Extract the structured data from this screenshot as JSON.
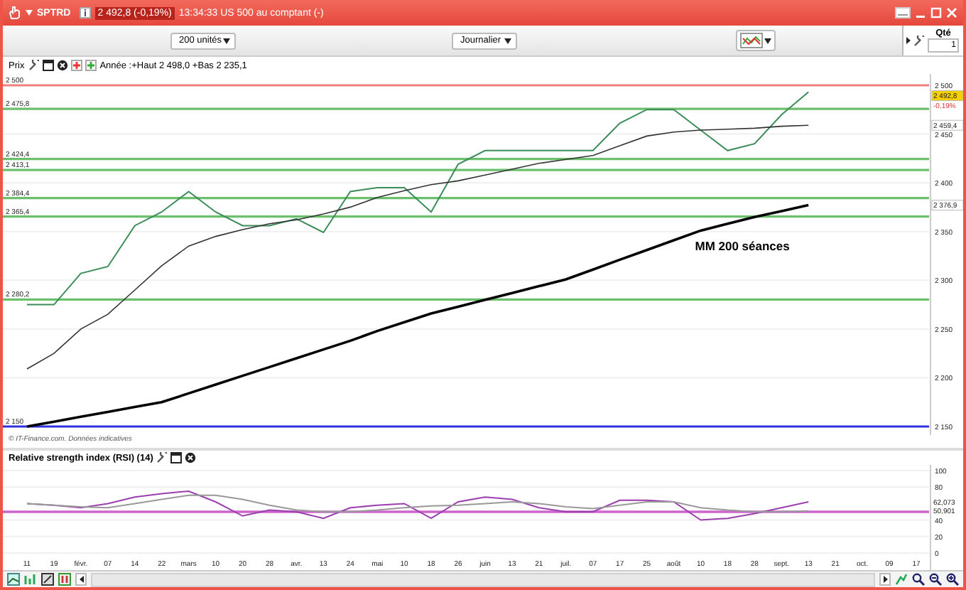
{
  "window": {
    "symbol": "SPTRD",
    "quote": "2 492,8 (-0,19%)",
    "subtitle": "13:34:33 US 500 au comptant (-)"
  },
  "toolbar": {
    "period_count": "200 unités",
    "interval": "Journalier",
    "quantity_label": "Qté",
    "quantity": "1"
  },
  "price_panel": {
    "title": "Prix",
    "summary": "Année :+Haut 2 498,0 +Bas 2 235,1",
    "chart_data": {
      "type": "line",
      "ylim": [
        2140,
        2500
      ],
      "grid": true,
      "yticks": [
        {
          "value": 2500,
          "label": "2 500"
        },
        {
          "value": 2450,
          "label": "2 450"
        },
        {
          "value": 2400,
          "label": "2 400"
        },
        {
          "value": 2350,
          "label": "2 350"
        },
        {
          "value": 2300,
          "label": "2 300"
        },
        {
          "value": 2250,
          "label": "2 250"
        },
        {
          "value": 2200,
          "label": "2 200"
        },
        {
          "value": 2150,
          "label": "2 150"
        }
      ],
      "series": [
        {
          "color": "#3c8c5a",
          "values": [
            2275,
            2275,
            2307,
            2314,
            2356,
            2370,
            2391,
            2370,
            2356,
            2356,
            2363,
            2349,
            2391,
            2395,
            2395,
            2370,
            2419,
            2433,
            2433,
            2433,
            2433,
            2433,
            2461,
            2475,
            2475,
            2454,
            2433,
            2440,
            2470,
            2493,
            null,
            null,
            null,
            null
          ]
        },
        {
          "color": "#333333",
          "values": [
            2209,
            2225,
            2250,
            2265,
            2290,
            2315,
            2335,
            2345,
            2352,
            2358,
            2362,
            2368,
            2375,
            2385,
            2392,
            2398,
            2402,
            2408,
            2414,
            2420,
            2424,
            2428,
            2438,
            2448,
            2452,
            2454,
            2455,
            2456,
            2458,
            2459,
            null,
            null,
            null,
            null
          ]
        },
        {
          "color": "#000000",
          "values": [
            2150,
            2155,
            2160,
            2165,
            2170,
            2175,
            2184,
            2193,
            2202,
            2211,
            2220,
            2229,
            2238,
            2248,
            2257,
            2266,
            2273,
            2280,
            2287,
            2294,
            2301,
            2311,
            2321,
            2331,
            2341,
            2351,
            2358,
            2365,
            2371,
            2377,
            null,
            null,
            null,
            null
          ]
        }
      ],
      "ref_lines": [
        {
          "axis": "y",
          "value": 2500,
          "label": "2 500",
          "color": "#f08080"
        },
        {
          "axis": "y",
          "value": 2475.8,
          "label": "2 475,8",
          "color": "#6cbf6c"
        },
        {
          "axis": "y",
          "value": 2424.4,
          "label": "2 424,4",
          "color": "#6cbf6c"
        },
        {
          "axis": "y",
          "value": 2413.1,
          "label": "2 413,1",
          "color": "#6cbf6c"
        },
        {
          "axis": "y",
          "value": 2384.4,
          "label": "2 384,4",
          "color": "#6cbf6c"
        },
        {
          "axis": "y",
          "value": 2365.4,
          "label": "2 365,4",
          "color": "#6cbf6c"
        },
        {
          "axis": "y",
          "value": 2280.2,
          "label": "2 280,2",
          "color": "#6cbf6c"
        },
        {
          "axis": "y",
          "value": 2150,
          "label": "2 150",
          "color": "#3030e0"
        }
      ],
      "annotations": [
        "MM 200 séances"
      ]
    },
    "axis_badges": [
      {
        "kind": "price",
        "text": "2 492,8"
      },
      {
        "kind": "change",
        "text": "-0,19%"
      },
      {
        "kind": "short_average",
        "text": "2 459,4"
      },
      {
        "kind": "long_average",
        "text": "2 376,9"
      }
    ]
  },
  "source": "© IT-Finance.com. Données indicatives",
  "rsi_panel": {
    "title": "Relative strength index (RSI) (14)",
    "chart_data": {
      "type": "line",
      "ylim": [
        0,
        100
      ],
      "grid": true,
      "categories": [
        "11",
        "19",
        "févr.",
        "07",
        "14",
        "22",
        "mars",
        "10",
        "20",
        "28",
        "avr.",
        "13",
        "24",
        "mai",
        "10",
        "18",
        "26",
        "juin",
        "13",
        "21",
        "juil.",
        "07",
        "17",
        "25",
        "août",
        "10",
        "18",
        "28",
        "sept.",
        "13",
        "21",
        "oct.",
        "09",
        "17"
      ],
      "yticks": [
        100,
        80,
        40,
        20,
        0
      ],
      "series": [
        {
          "color": "#9b3fae",
          "values": [
            60,
            58,
            55,
            60,
            68,
            72,
            75,
            62,
            45,
            52,
            50,
            42,
            55,
            58,
            60,
            42,
            62,
            68,
            65,
            55,
            50,
            50,
            64,
            64,
            62,
            40,
            42,
            48,
            55,
            62,
            null,
            null,
            null,
            null
          ]
        },
        {
          "color": "#999999",
          "values": [
            60,
            58,
            56,
            55,
            60,
            65,
            70,
            70,
            65,
            58,
            52,
            50,
            50,
            52,
            55,
            57,
            58,
            60,
            62,
            60,
            56,
            54,
            58,
            62,
            62,
            55,
            52,
            50,
            50,
            51,
            null,
            null,
            null,
            null
          ]
        }
      ],
      "ref_lines": [
        {
          "axis": "y",
          "value": 50,
          "color": "#cc66cc"
        }
      ]
    },
    "axis_badges": [
      {
        "kind": "rsi",
        "text": "62,073"
      },
      {
        "kind": "signal",
        "text": "50,901"
      }
    ]
  }
}
